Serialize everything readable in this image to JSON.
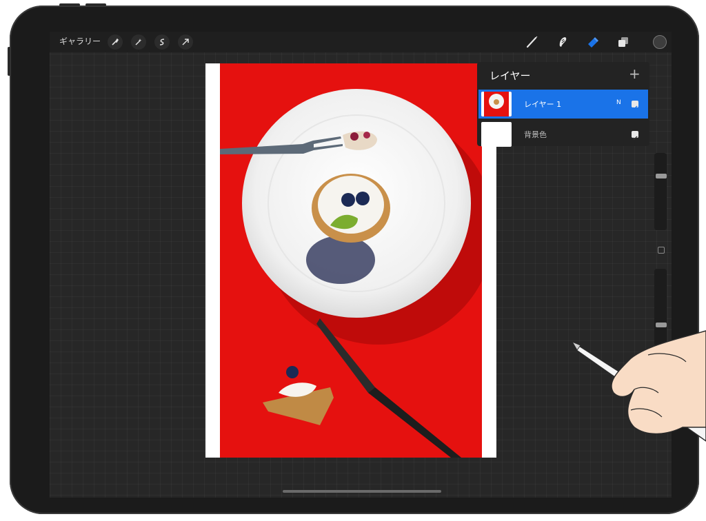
{
  "toolbar": {
    "gallery_label": "ギャラリー",
    "left_tools": [
      "wrench-icon",
      "magic-wand-icon",
      "selection-icon",
      "transform-arrow-icon"
    ],
    "right_tools": [
      "brush-icon",
      "smudge-icon",
      "eraser-icon",
      "layers-icon",
      "color-icon"
    ],
    "active_tool": "eraser-icon",
    "accent_color": "#1a73e8"
  },
  "layers_panel": {
    "title": "レイヤー",
    "add_label": "+",
    "layers": [
      {
        "name": "レイヤー 1",
        "blend_mode": "N",
        "visible": true,
        "selected": true
      },
      {
        "name": "背景色",
        "visible": true,
        "selected": false
      }
    ]
  },
  "canvas": {
    "background_color": "#ffffff",
    "photo_background": "#e5110f"
  }
}
